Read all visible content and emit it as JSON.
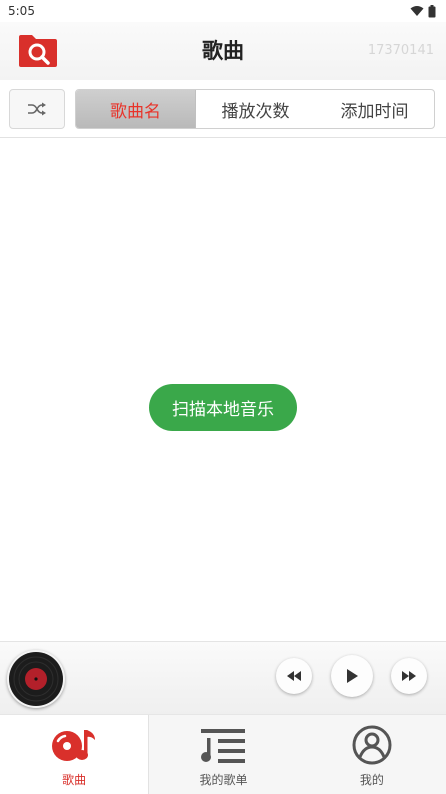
{
  "status_bar": {
    "time": "5:05"
  },
  "header": {
    "title": "歌曲",
    "user_id": "17370141"
  },
  "sort": {
    "tabs": [
      {
        "label": "歌曲名",
        "active": true
      },
      {
        "label": "播放次数",
        "active": false
      },
      {
        "label": "添加时间",
        "active": false
      }
    ]
  },
  "content": {
    "scan_label": "扫描本地音乐"
  },
  "bottom_nav": {
    "items": [
      {
        "label": "歌曲",
        "icon": "songs-icon",
        "active": true
      },
      {
        "label": "我的歌单",
        "icon": "playlist-icon",
        "active": false
      },
      {
        "label": "我的",
        "icon": "profile-icon",
        "active": false
      }
    ]
  },
  "colors": {
    "accent_red": "#d9302b",
    "scan_green": "#3aa84a",
    "active_tab_text": "#e8342a"
  }
}
